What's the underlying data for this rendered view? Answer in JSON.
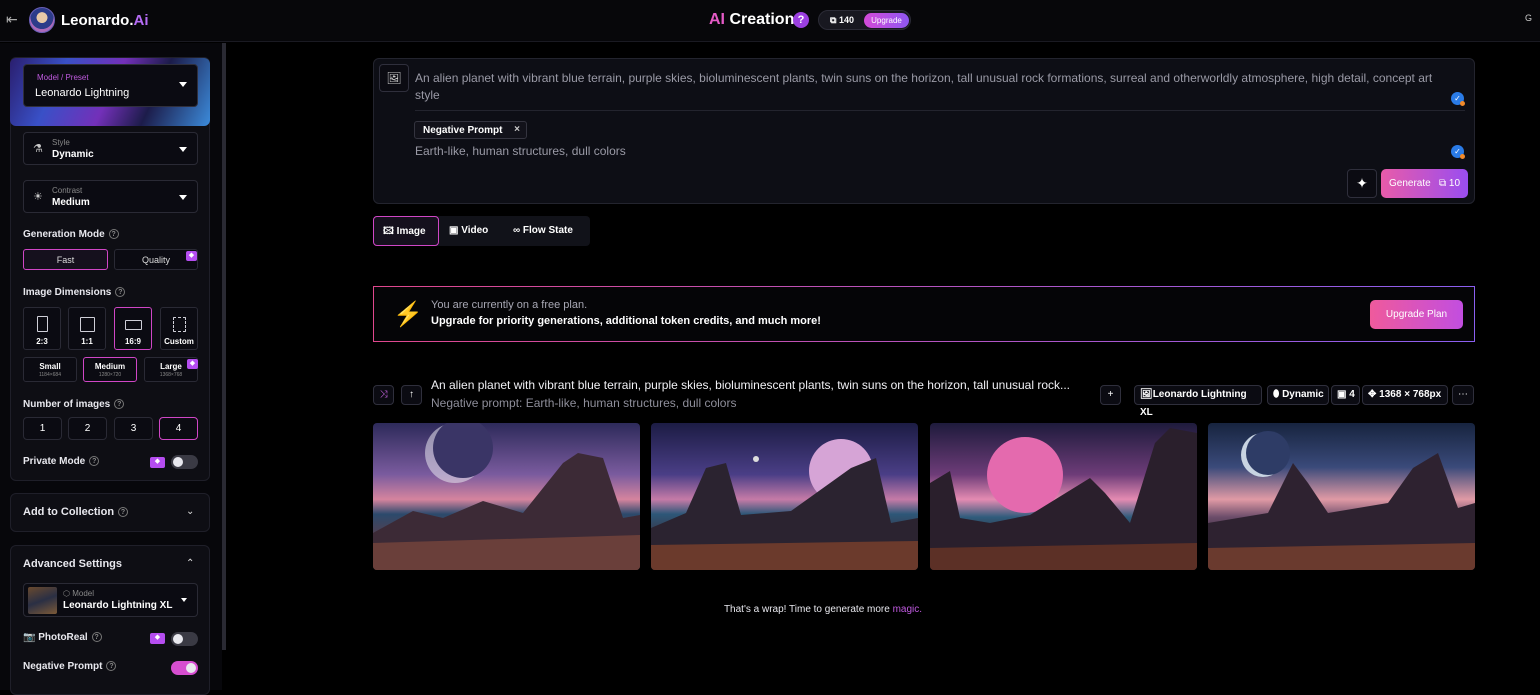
{
  "app": {
    "brand_main": "Leonardo.",
    "brand_ai": "Ai",
    "page_title_ai": "AI",
    "page_title_rest": " Creation",
    "help": "?",
    "tokens": "140",
    "upgrade": "Upgrade",
    "top_right": "G"
  },
  "sidebar": {
    "model_preset_label": "Model / Preset",
    "model_preset_value": "Leonardo Lightning",
    "style_label": "Style",
    "style_value": "Dynamic",
    "contrast_label": "Contrast",
    "contrast_value": "Medium",
    "generation_mode_label": "Generation Mode",
    "gen_fast": "Fast",
    "gen_quality": "Quality",
    "image_dimensions_label": "Image Dimensions",
    "dims": [
      "2:3",
      "1:1",
      "16:9",
      "Custom"
    ],
    "sizes": [
      {
        "label": "Small",
        "sub": "1184×684"
      },
      {
        "label": "Medium",
        "sub": "1280×720"
      },
      {
        "label": "Large",
        "sub": "1368×768"
      }
    ],
    "number_of_images_label": "Number of images",
    "numbers": [
      "1",
      "2",
      "3",
      "4"
    ],
    "private_mode_label": "Private Mode",
    "add_to_collection_label": "Add to Collection",
    "advanced_settings_label": "Advanced Settings",
    "adv_model_label": "Model",
    "adv_model_value": "Leonardo Lightning XL",
    "photoreal_label": "PhotoReal",
    "negative_prompt_label": "Negative Prompt"
  },
  "prompt": {
    "text": "An alien planet with vibrant blue terrain, purple skies, bioluminescent plants, twin suns on the horizon, tall unusual rock formations, surreal and otherworldly atmosphere, high detail, concept art style",
    "negative_chip": "Negative Prompt",
    "negative_text": "Earth-like, human structures, dull colors",
    "generate": "Generate",
    "generate_cost": "10"
  },
  "mode_tabs": [
    "Image",
    "Video",
    "Flow State"
  ],
  "banner": {
    "line1": "You are currently on a free plan.",
    "line2": "Upgrade for priority generations, additional token credits, and much more!",
    "button": "Upgrade Plan"
  },
  "history": {
    "prompt": "An alien planet with vibrant blue terrain, purple skies, bioluminescent plants, twin suns on the horizon, tall unusual rock...",
    "negative": "Negative prompt: Earth-like, human structures, dull colors",
    "model_chip": "Leonardo Lightning XL",
    "style_chip": "Dynamic",
    "count_chip": "4",
    "size_chip": "1368 × 768px"
  },
  "footer": {
    "wrap_text": "That's a wrap! Time to generate more ",
    "wrap_magic": "magic."
  }
}
